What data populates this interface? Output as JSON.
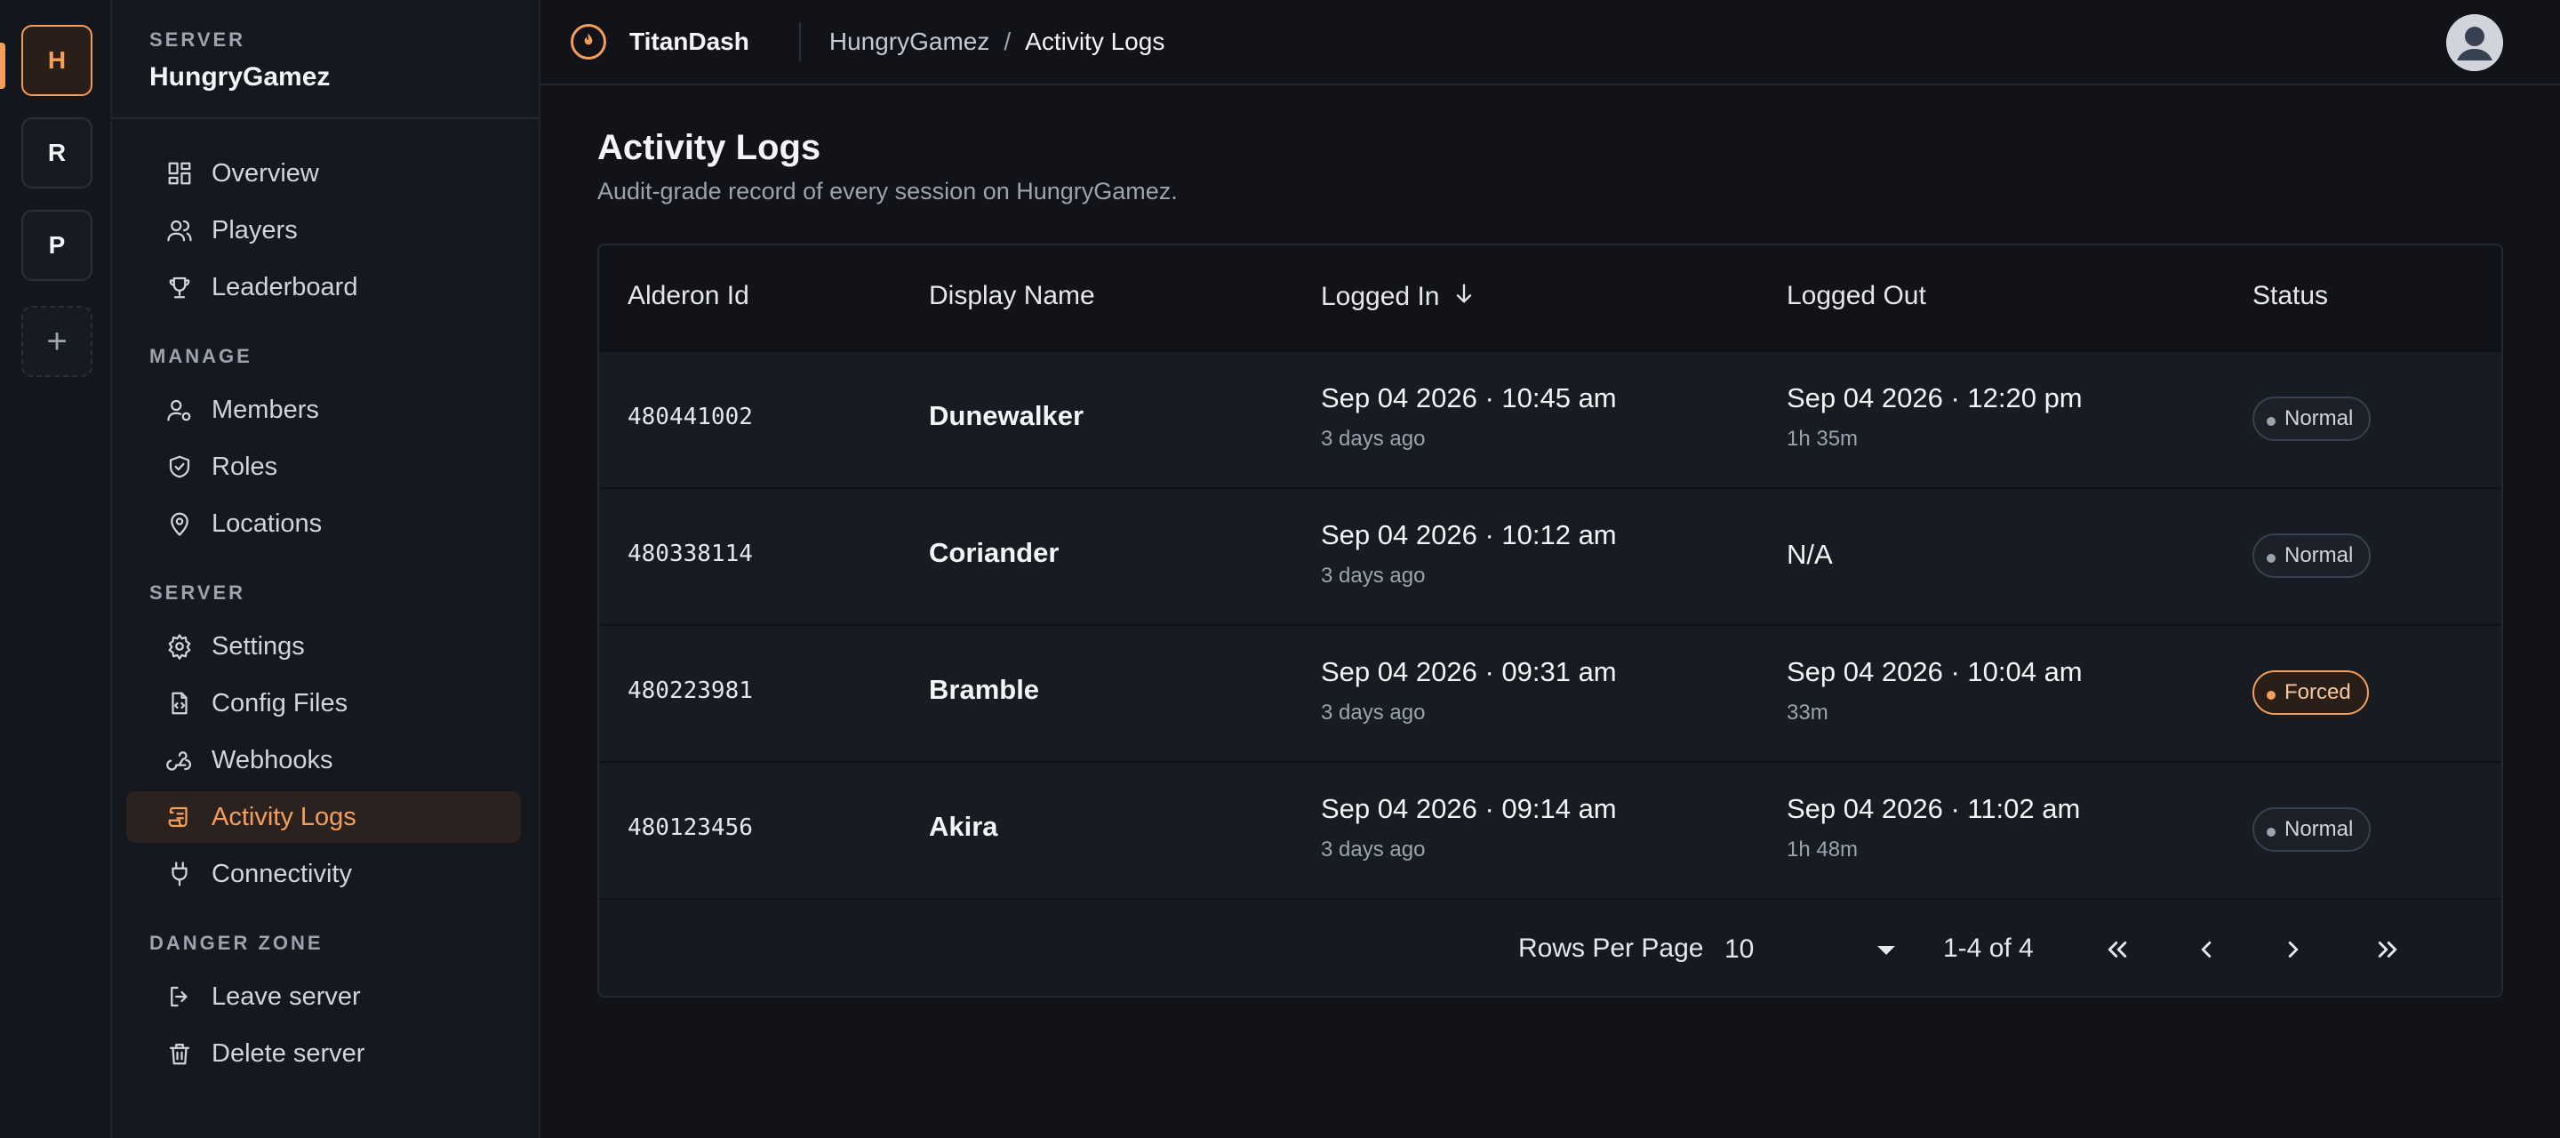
{
  "rail": {
    "servers": [
      {
        "letter": "H",
        "active": true
      },
      {
        "letter": "R",
        "active": false
      },
      {
        "letter": "P",
        "active": false
      }
    ],
    "add_label": "+"
  },
  "sidebar": {
    "kicker": "SERVER",
    "server_name": "HungryGamez",
    "sections": {
      "manage": "MANAGE",
      "server": "SERVER",
      "danger": "DANGER ZONE"
    },
    "items": {
      "overview": "Overview",
      "players": "Players",
      "leaderboard": "Leaderboard",
      "members": "Members",
      "roles": "Roles",
      "locations": "Locations",
      "settings": "Settings",
      "config_files": "Config Files",
      "webhooks": "Webhooks",
      "activity_logs": "Activity Logs",
      "connectivity": "Connectivity",
      "leave_server": "Leave server",
      "delete_server": "Delete server"
    },
    "active_item": "activity_logs"
  },
  "topbar": {
    "brand": "TitanDash",
    "breadcrumb": {
      "parent": "HungryGamez",
      "separator": "/",
      "current": "Activity Logs"
    }
  },
  "page": {
    "title": "Activity Logs",
    "subtitle": "Audit-grade record of every session on HungryGamez."
  },
  "table": {
    "columns": {
      "alderon_id": "Alderon Id",
      "display_name": "Display Name",
      "logged_in": "Logged In",
      "logged_out": "Logged Out",
      "status": "Status"
    },
    "sort": {
      "column": "logged_in",
      "direction": "desc"
    },
    "rows": [
      {
        "alderon_id": "480441002",
        "display_name": "Dunewalker",
        "logged_in": "Sep 04 2026 · 10:45 am",
        "logged_in_rel": "3 days ago",
        "logged_out": "Sep 04 2026 · 12:20 pm",
        "logged_out_dur": "1h 35m",
        "status": "Normal"
      },
      {
        "alderon_id": "480338114",
        "display_name": "Coriander",
        "logged_in": "Sep 04 2026 · 10:12 am",
        "logged_in_rel": "3 days ago",
        "logged_out": "N/A",
        "logged_out_dur": "",
        "status": "Normal"
      },
      {
        "alderon_id": "480223981",
        "display_name": "Bramble",
        "logged_in": "Sep 04 2026 · 09:31 am",
        "logged_in_rel": "3 days ago",
        "logged_out": "Sep 04 2026 · 10:04 am",
        "logged_out_dur": "33m",
        "status": "Forced"
      },
      {
        "alderon_id": "480123456",
        "display_name": "Akira",
        "logged_in": "Sep 04 2026 · 09:14 am",
        "logged_in_rel": "3 days ago",
        "logged_out": "Sep 04 2026 · 11:02 am",
        "logged_out_dur": "1h 48m",
        "status": "Normal"
      }
    ],
    "footer": {
      "rows_per_page_label": "Rows Per Page",
      "rows_per_page_value": "10",
      "range": "1-4 of 4"
    }
  },
  "colors": {
    "accent": "#f59e5b",
    "background": "#111318",
    "sidebar": "#15181f",
    "row": "#171b22"
  }
}
